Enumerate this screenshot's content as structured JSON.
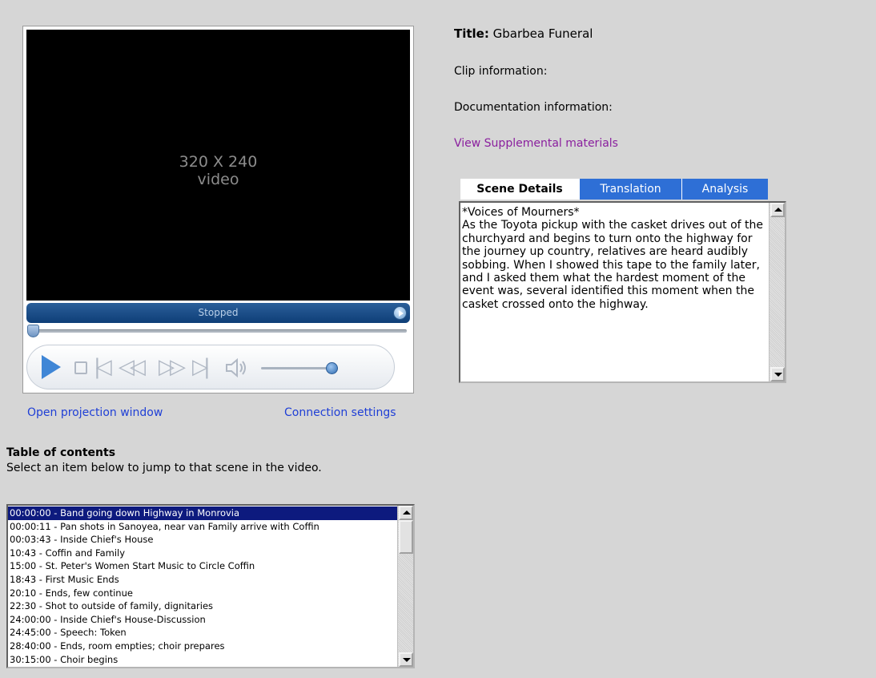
{
  "player": {
    "video_label": "320 X 240\nvideo",
    "status": "Stopped",
    "icons": [
      "play-icon",
      "stop-icon",
      "previous-track-icon",
      "rewind-icon",
      "fast-forward-icon",
      "next-track-icon",
      "volume-icon"
    ],
    "accent_color": "#0e3e77"
  },
  "links": {
    "open_projection": "Open projection window",
    "connection_settings": "Connection settings",
    "view_supplemental": "View Supplemental materials"
  },
  "toc": {
    "heading": "Table of contents",
    "hint": "Select an item below to jump to that scene in the video.",
    "items": [
      "00:00:00 - Band going down Highway in Monrovia",
      "00:00:11 - Pan shots in Sanoyea, near van Family arrive with Coffin",
      "00:03:43 - Inside Chief's House",
      "10:43 - Coffin and Family",
      "15:00 - St. Peter's Women Start Music to Circle Coffin",
      "18:43 - First Music Ends",
      "20:10 - Ends, few continue",
      "22:30 - Shot to outside of family, dignitaries",
      "24:00:00 - Inside Chief's House-Discussion",
      "24:45:00 - Speech: Token",
      "28:40:00 - Ends, room empties; choir prepares",
      "30:15:00 - Choir begins"
    ],
    "selected_index": 0
  },
  "info": {
    "title_label": "Title:",
    "title_value": "Gbarbea Funeral",
    "clip_info": "Clip information:",
    "doc_info": "Documentation information:"
  },
  "tabs": {
    "scene": "Scene Details",
    "translation": "Translation",
    "analysis": "Analysis",
    "active": "scene",
    "inactive_color": "#2e6fd6"
  },
  "scene_text": "*Voices of Mourners*\nAs the Toyota pickup with the casket drives out of the churchyard and begins to turn onto the highway for the journey up country, relatives are heard audibly sobbing. When I showed this tape to the family later, and I asked them what the hardest moment of the event was, several identified this moment when the casket crossed onto the highway."
}
